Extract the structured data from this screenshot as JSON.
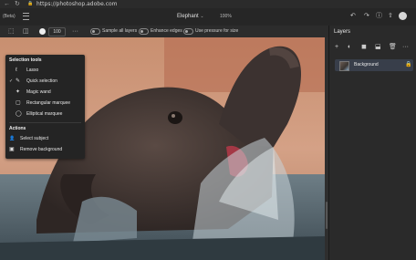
{
  "browser": {
    "back_glyph": "←",
    "reload_glyph": "↻",
    "lock_glyph": "🔒",
    "url": "https://photoshop.adobe.com"
  },
  "appbar": {
    "badge": "(Beta)",
    "document_title": "Elephant",
    "title_chevron": "⌄",
    "zoom": "100%",
    "undo_glyph": "↶",
    "redo_glyph": "↷",
    "info_glyph": "ⓘ",
    "share_glyph": "⇧",
    "cloud_glyph": "☁"
  },
  "options": {
    "tool_glyph": "⬚",
    "mode_glyph": "◫",
    "brush_size": "100",
    "more_glyph": "···",
    "sample_all_layers": "Sample all layers",
    "enhance_edges": "Enhance edges",
    "use_pressure": "Use pressure for size"
  },
  "flyout": {
    "selection_heading": "Selection tools",
    "tools": [
      {
        "label": "Lasso",
        "glyph": "ℓ",
        "selected": false
      },
      {
        "label": "Quick selection",
        "glyph": "✎",
        "selected": true
      },
      {
        "label": "Magic wand",
        "glyph": "✦",
        "selected": false
      },
      {
        "label": "Rectangular marquee",
        "glyph": "▢",
        "selected": false
      },
      {
        "label": "Elliptical marquee",
        "glyph": "◯",
        "selected": false
      }
    ],
    "check_glyph": "✓",
    "actions_heading": "Actions",
    "actions": [
      {
        "label": "Select subject",
        "glyph": "👤"
      },
      {
        "label": "Remove background",
        "glyph": "▣"
      }
    ]
  },
  "layers": {
    "title": "Layers",
    "tools": [
      "+",
      "◐",
      "◼",
      "⬓",
      "🗑",
      "···"
    ],
    "items": [
      {
        "name": "Background",
        "locked": true,
        "lock_glyph": "🔒"
      }
    ]
  },
  "colors": {
    "panel_bg": "#2a2a2a",
    "selected_layer": "#383e4a",
    "canvas_bg": "#3a3a3a"
  }
}
